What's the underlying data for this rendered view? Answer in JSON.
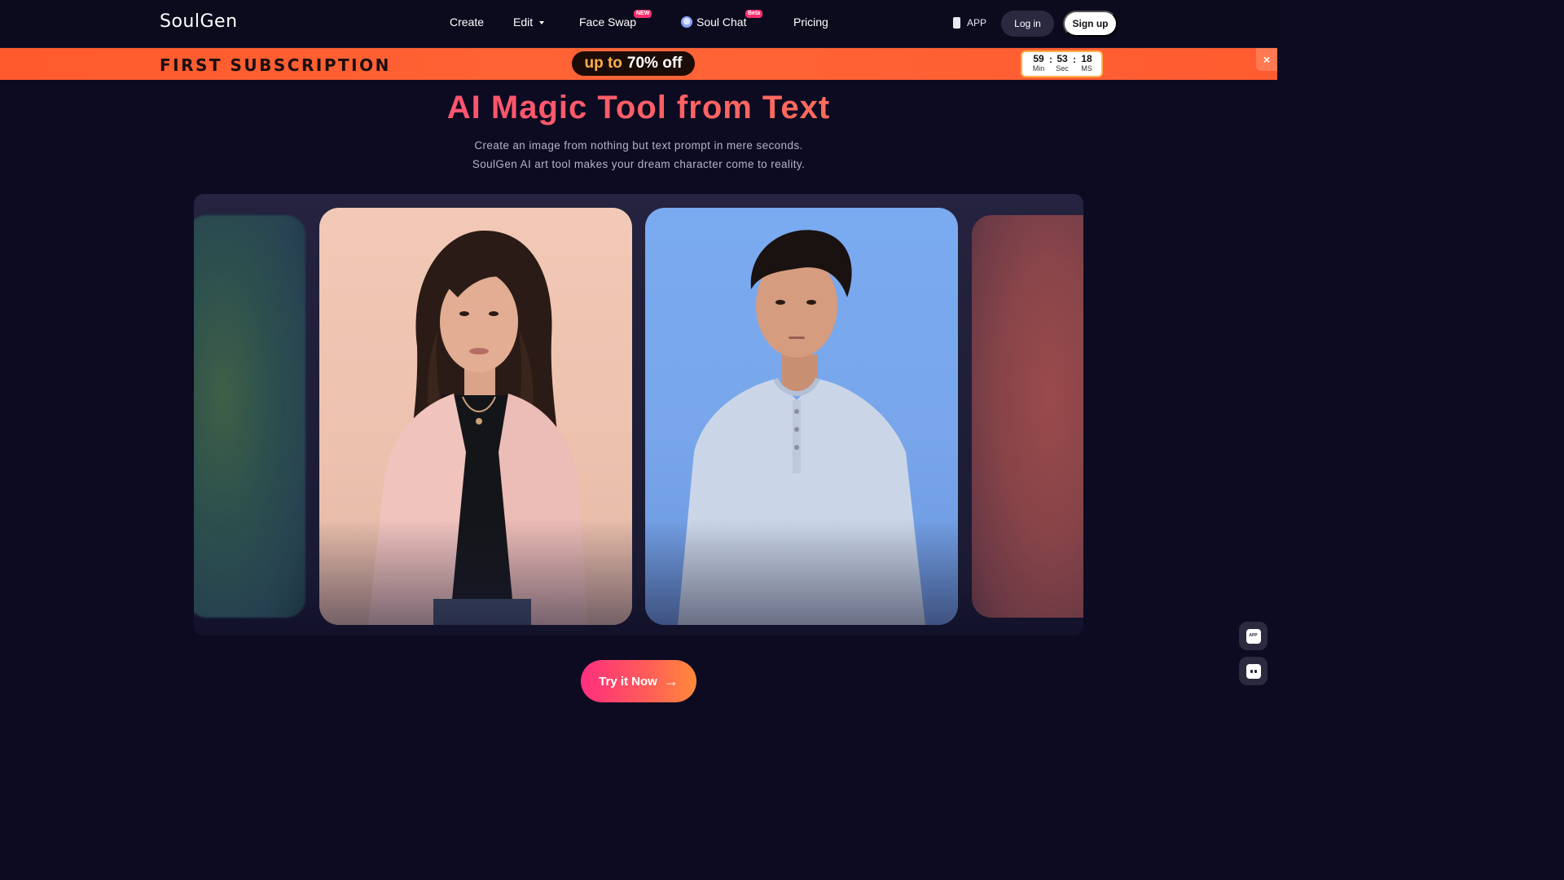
{
  "header": {
    "logo": "SoulGen",
    "nav": {
      "create": "Create",
      "edit": "Edit",
      "face_swap": "Face Swap",
      "face_swap_tag": "NEW",
      "soul_chat": "Soul Chat",
      "soul_chat_tag": "Beta",
      "pricing": "Pricing"
    },
    "app_label": "APP",
    "login_label": "Log in",
    "signup_label": "Sign up"
  },
  "promo": {
    "title": "FIRST SUBSCRIPTION",
    "upto": "up to",
    "percent": "70% off",
    "timer": {
      "min": "59",
      "sec": "53",
      "ms": "18",
      "min_label": "Min",
      "sec_label": "Sec",
      "ms_label": "MS",
      "sep": ":"
    },
    "close": "×"
  },
  "hero": {
    "title": "AI Magic Tool from Text",
    "subtitle_line1": "Create an image from nothing but text prompt in mere seconds.",
    "subtitle_line2": "SoulGen AI art tool makes your dream character come to reality."
  },
  "cta": {
    "label": "Try it Now",
    "arrow": "→"
  },
  "floating": {
    "app_label": "APP"
  },
  "colors": {
    "background": "#0d0b22",
    "promo_orange": "#ff5a2e",
    "accent_pink": "#ff2f7e",
    "accent_orange": "#ff8a3a"
  }
}
